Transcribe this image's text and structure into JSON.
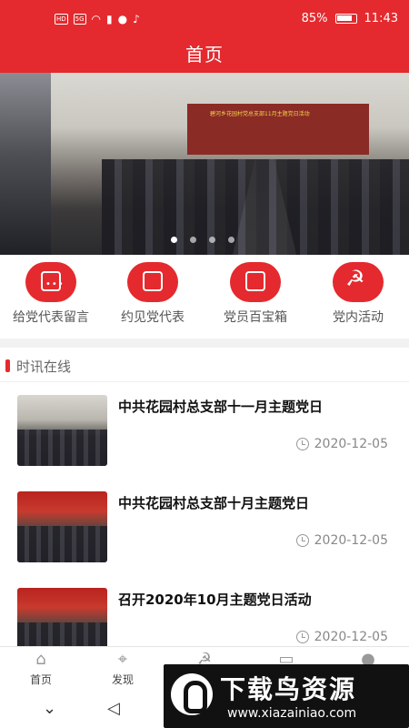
{
  "status_bar": {
    "left_badges": [
      "HD",
      "5G"
    ],
    "battery_text": "85%",
    "time": "11:43"
  },
  "header": {
    "title": "首页"
  },
  "banner": {
    "caption": "碧河乡花园村党总支部11月主题党日活动",
    "page_count": 4,
    "active_index": 0
  },
  "quick_menu": [
    {
      "label": "给党代表留言",
      "icon": "message-icon"
    },
    {
      "label": "约见党代表",
      "icon": "appointment-icon"
    },
    {
      "label": "党员百宝箱",
      "icon": "toolbox-icon"
    },
    {
      "label": "党内活动",
      "icon": "party-emblem-icon"
    }
  ],
  "news_section": {
    "title": "时讯在线",
    "items": [
      {
        "title": "中共花园村总支部十一月主题党日",
        "date": "2020-12-05"
      },
      {
        "title": "中共花园村总支部十月主题党日",
        "date": "2020-12-05"
      },
      {
        "title": "召开2020年10月主题党日活动",
        "date": "2020-12-05"
      }
    ]
  },
  "tab_bar": [
    {
      "label": "首页",
      "icon": "home-icon"
    },
    {
      "label": "发现",
      "icon": "map-icon"
    },
    {
      "label": "",
      "icon": "party-icon"
    },
    {
      "label": "",
      "icon": "id-card-icon"
    },
    {
      "label": "",
      "icon": "user-icon"
    }
  ],
  "watermark": {
    "title": "下载鸟资源",
    "url": "www.xiazainiao.com"
  },
  "colors": {
    "brand_red": "#e42a2e"
  }
}
